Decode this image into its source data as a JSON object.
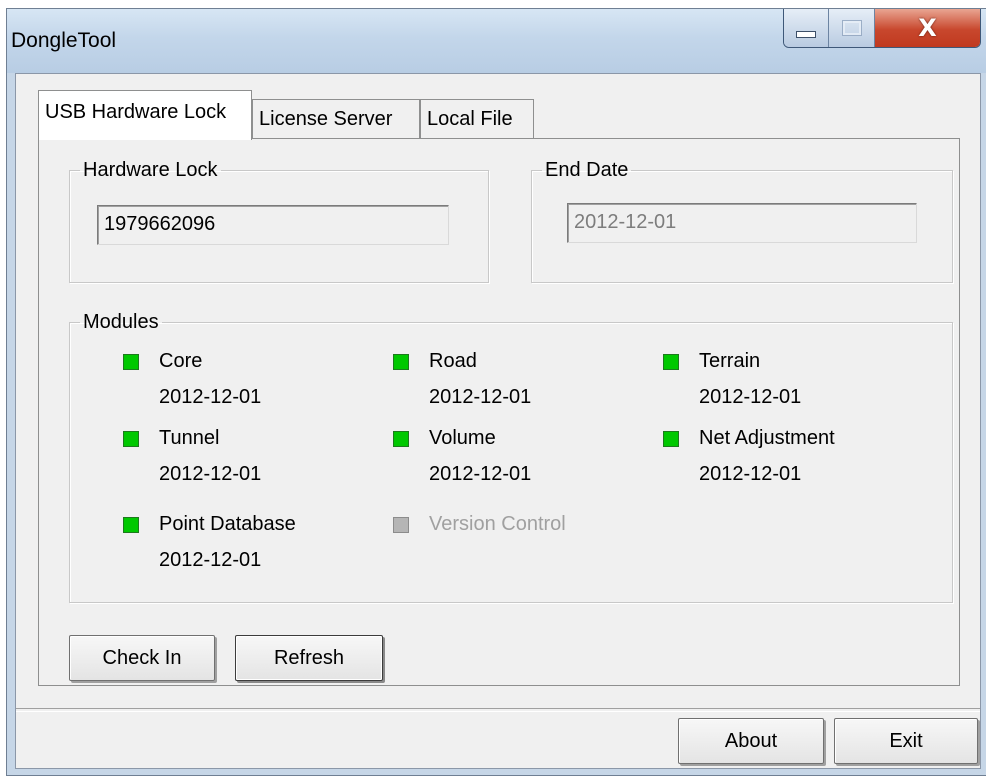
{
  "window": {
    "title": "DongleTool"
  },
  "caption_buttons": {
    "minimize_icon": "minimize-icon",
    "maximize_icon": "maximize-icon",
    "close_icon": "close-icon",
    "close_glyph": "X"
  },
  "tabs": [
    {
      "label": "USB Hardware Lock",
      "active": true
    },
    {
      "label": "License Server",
      "active": false
    },
    {
      "label": "Local File",
      "active": false
    }
  ],
  "hardware_lock": {
    "legend": "Hardware Lock",
    "value": "1979662096"
  },
  "end_date": {
    "legend": "End Date",
    "value": "2012-12-01"
  },
  "modules": {
    "legend": "Modules",
    "items": [
      {
        "name": "Core",
        "date": "2012-12-01",
        "status": "active"
      },
      {
        "name": "Road",
        "date": "2012-12-01",
        "status": "active"
      },
      {
        "name": "Terrain",
        "date": "2012-12-01",
        "status": "active"
      },
      {
        "name": "Tunnel",
        "date": "2012-12-01",
        "status": "active"
      },
      {
        "name": "Volume",
        "date": "2012-12-01",
        "status": "active"
      },
      {
        "name": "Net Adjustment",
        "date": "2012-12-01",
        "status": "active"
      },
      {
        "name": "Point Database",
        "date": "2012-12-01",
        "status": "active"
      },
      {
        "name": "Version Control",
        "date": "",
        "status": "inactive"
      }
    ],
    "colors": {
      "active": "#00c800",
      "inactive": "#b5b5b5"
    }
  },
  "buttons": {
    "check_in": "Check In",
    "refresh": "Refresh",
    "about": "About",
    "exit": "Exit"
  }
}
